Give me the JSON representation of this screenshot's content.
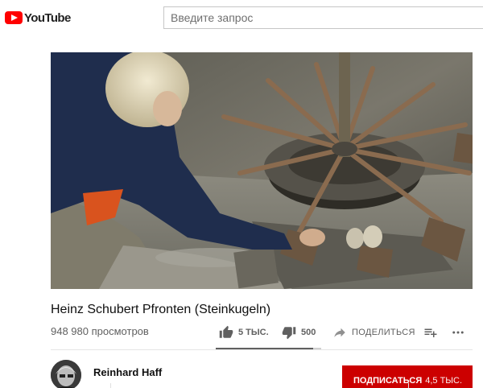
{
  "masthead": {
    "logo_text": "YouTube",
    "search_placeholder": "Введите запрос"
  },
  "video": {
    "title": "Heinz Schubert Pfronten (Steinkugeln)",
    "views": "948 980 просмотров",
    "like_sentiment_fraction": 0.92
  },
  "actions": {
    "likes": "5 ТЫС.",
    "dislikes": "500",
    "share": "ПОДЕЛИТЬСЯ",
    "icons": [
      "thumb-up-icon",
      "thumb-down-icon",
      "share-icon",
      "add-to-playlist-icon",
      "more-icon"
    ]
  },
  "channel": {
    "name": "Reinhard Haff",
    "subscribe_label": "ПОДПИСАТЬСЯ",
    "subscriber_count": "4,5 ТЫС."
  },
  "colors": {
    "brand_red": "#ff0000",
    "subscribe_red": "#cc0000",
    "secondary_text": "#606060"
  }
}
